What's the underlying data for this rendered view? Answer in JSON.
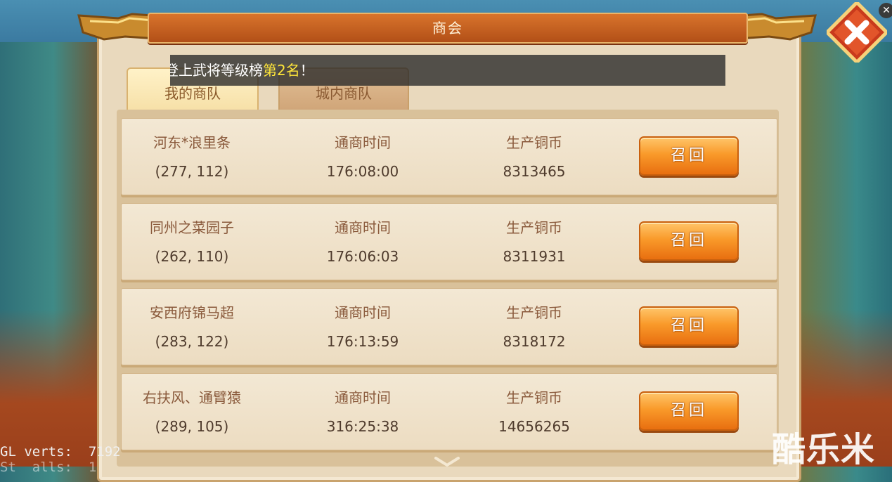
{
  "window": {
    "title": "商会"
  },
  "tabs": [
    {
      "label": "我的商队",
      "active": true
    },
    {
      "label": "城内商队",
      "active": false
    }
  ],
  "notice": {
    "prefix": "登上武将等级榜",
    "highlight": "第2名",
    "suffix": "！"
  },
  "caravans": [
    {
      "name": "河东*浪里条",
      "coords": "(277, 112)",
      "time_label": "通商时间",
      "time": "176:08:00",
      "coin_label": "生产铜币",
      "coin": "8313465",
      "button": "召回"
    },
    {
      "name": "同州之菜园子",
      "coords": "(262, 110)",
      "time_label": "通商时间",
      "time": "176:06:03",
      "coin_label": "生产铜币",
      "coin": "8311931",
      "button": "召回"
    },
    {
      "name": "安西府锦马超",
      "coords": "(283, 122)",
      "time_label": "通商时间",
      "time": "176:13:59",
      "coin_label": "生产铜币",
      "coin": "8318172",
      "button": "召回"
    },
    {
      "name": "右扶风、通臂猿",
      "coords": "(289, 105)",
      "time_label": "通商时间",
      "time": "316:25:38",
      "coin_label": "生产铜币",
      "coin": "14656265",
      "button": "召回"
    }
  ],
  "debug": {
    "line1": "GL verts:  7192",
    "line2": "St  alls:  1  "
  },
  "watermark": "酷乐米",
  "icons": {
    "close": "close-x-icon",
    "scroll": "chevron-down-icon",
    "overlay_close": "small-close-icon"
  },
  "colors": {
    "accent": "#e86f10",
    "title_bar": "#c4611f",
    "highlight": "#ffe63a",
    "panel": "#e9d9bd"
  }
}
